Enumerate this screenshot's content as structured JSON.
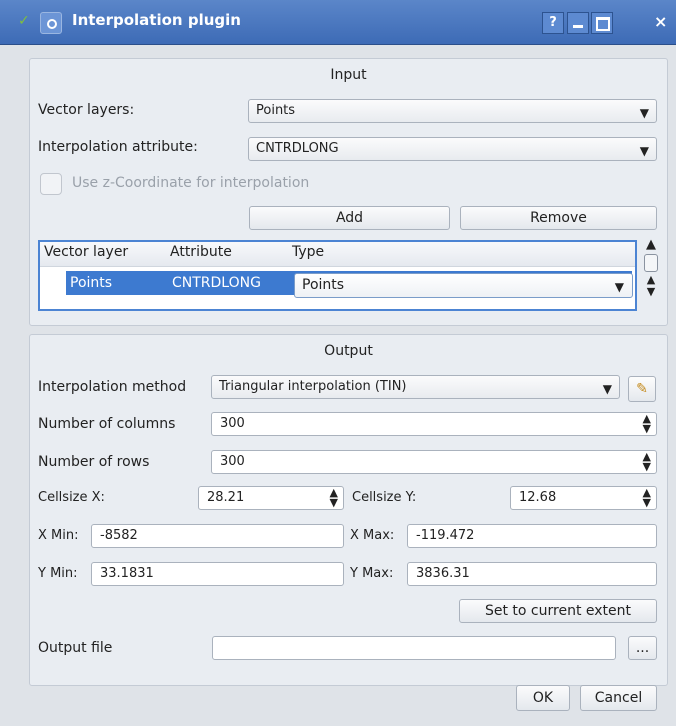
{
  "window": {
    "title": "Interpolation plugin",
    "help_btn": "?",
    "close_btn": "×"
  },
  "input": {
    "title": "Input",
    "vector_layers_label": "Vector layers:",
    "vector_layers_value": "Points",
    "interpolation_attribute_label": "Interpolation attribute:",
    "interpolation_attribute_value": "CNTRDLONG",
    "use_z_label": "Use z-Coordinate for interpolation",
    "add_label": "Add",
    "remove_label": "Remove",
    "table": {
      "headers": [
        "Vector layer",
        "Attribute",
        "Type"
      ],
      "rows": [
        {
          "layer": "Points",
          "attribute": "CNTRDLONG",
          "type": "Points"
        }
      ]
    }
  },
  "output": {
    "title": "Output",
    "method_label": "Interpolation method",
    "method_value": "Triangular interpolation (TIN)",
    "columns_label": "Number of columns",
    "columns_value": "300",
    "rows_label": "Number of rows",
    "rows_value": "300",
    "cellsize_x_label": "Cellsize X:",
    "cellsize_x_value": "28.21",
    "cellsize_y_label": "Cellsize Y:",
    "cellsize_y_value": "12.68",
    "xmin_label": "X Min:",
    "xmin_value": "-8582",
    "xmax_label": "X Max:",
    "xmax_value": "-119.472",
    "ymin_label": "Y Min:",
    "ymin_value": "33.1831",
    "ymax_label": "Y Max:",
    "ymax_value": "3836.31",
    "set_extent_label": "Set to current extent",
    "output_file_label": "Output file",
    "output_file_value": "",
    "browse_label": "..."
  },
  "footer": {
    "ok_label": "OK",
    "cancel_label": "Cancel"
  }
}
